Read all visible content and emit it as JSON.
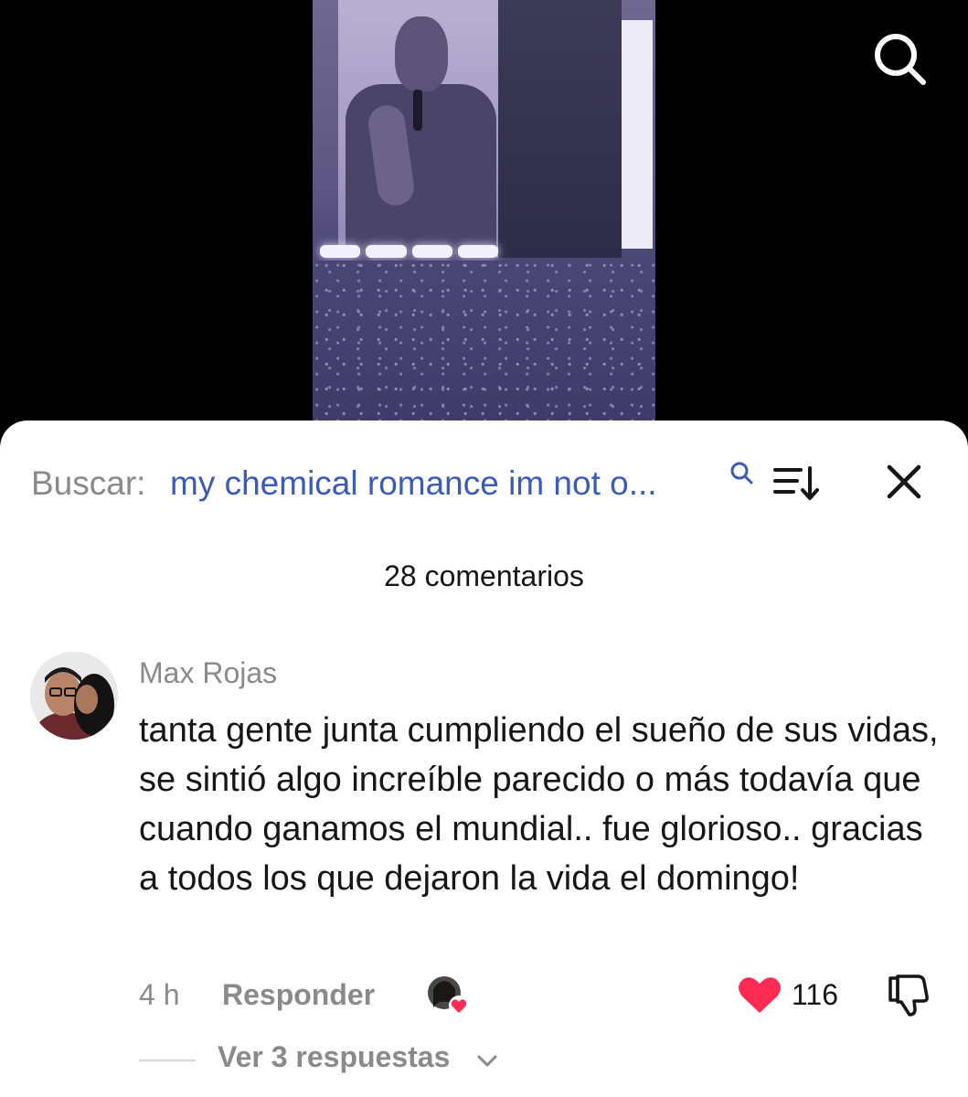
{
  "colors": {
    "accent_link": "#3c5bb8",
    "like_red": "#fe2c55",
    "muted_gray": "#8a8a8a"
  },
  "icons": {
    "top_search": "search-icon",
    "sort": "sort-icon",
    "close": "close-icon",
    "like": "heart-icon",
    "dislike": "dislike-icon"
  },
  "search": {
    "prefix": "Buscar:",
    "query": "my chemical romance im not o..."
  },
  "comments": {
    "count_label": "28 comentarios",
    "items": [
      {
        "author": "Max Rojas",
        "text": "tanta gente junta cumpliendo el sueño de sus vidas, se sintió algo increíble parecido o más todavía que cuando ganamos el mundial.. fue glorioso.. gracias a todos los que dejaron la vida el domingo!",
        "time": "4 h",
        "reply_label": "Responder",
        "likes": "116",
        "replies_label": "Ver 3 respuestas"
      }
    ]
  }
}
